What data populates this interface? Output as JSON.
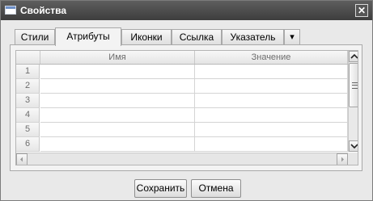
{
  "window": {
    "title": "Свойства",
    "close_glyph": "✕"
  },
  "tabs": [
    {
      "label": "Стили",
      "active": false
    },
    {
      "label": "Атрибуты",
      "active": true
    },
    {
      "label": "Иконки",
      "active": false
    },
    {
      "label": "Ссылка",
      "active": false
    },
    {
      "label": "Указатель",
      "active": false
    }
  ],
  "tab_overflow_glyph": "▾",
  "grid": {
    "columns": [
      "Имя",
      "Значение"
    ],
    "row_numbers": [
      "1",
      "2",
      "3",
      "4",
      "5",
      "6"
    ]
  },
  "buttons": {
    "save": "Сохранить",
    "cancel": "Отмена"
  },
  "icons": {
    "window": "window-icon",
    "close": "close-icon",
    "overflow": "chevron-down-icon",
    "scroll_up": "scroll-up-arrow-icon",
    "scroll_down": "scroll-down-arrow-icon",
    "scroll_left": "scroll-left-arrow-icon",
    "scroll_right": "scroll-right-arrow-icon"
  },
  "colors": {
    "titlebar": "#4a4a4a",
    "dialog_bg": "#e9e9e9",
    "border": "#a9a9a9"
  }
}
